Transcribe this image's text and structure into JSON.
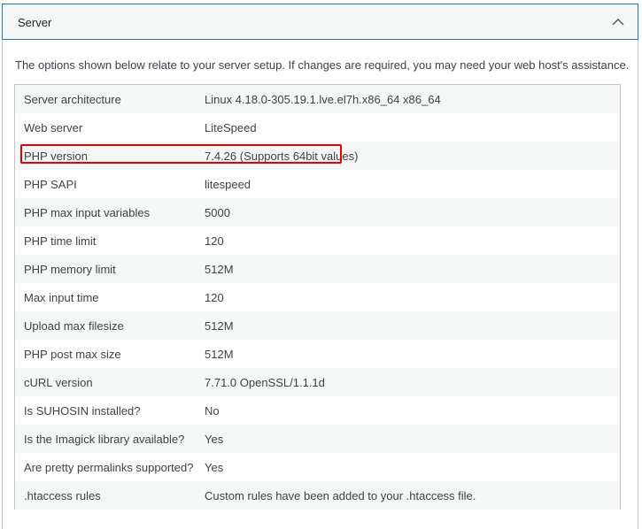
{
  "panel": {
    "title": "Server",
    "toggle_icon": "chevron-up-icon"
  },
  "intro": "The options shown below relate to your server setup. If changes are required, you may need your web host's assistance.",
  "rows": [
    {
      "label": "Server architecture",
      "value": "Linux 4.18.0-305.19.1.lve.el7h.x86_64 x86_64"
    },
    {
      "label": "Web server",
      "value": "LiteSpeed"
    },
    {
      "label": "PHP version",
      "value": "7.4.26 (Supports 64bit values)"
    },
    {
      "label": "PHP SAPI",
      "value": "litespeed"
    },
    {
      "label": "PHP max input variables",
      "value": "5000"
    },
    {
      "label": "PHP time limit",
      "value": "120"
    },
    {
      "label": "PHP memory limit",
      "value": "512M"
    },
    {
      "label": "Max input time",
      "value": "120"
    },
    {
      "label": "Upload max filesize",
      "value": "512M"
    },
    {
      "label": "PHP post max size",
      "value": "512M"
    },
    {
      "label": "cURL version",
      "value": "7.71.0 OpenSSL/1.1.1d"
    },
    {
      "label": "Is SUHOSIN installed?",
      "value": "No"
    },
    {
      "label": "Is the Imagick library available?",
      "value": "Yes"
    },
    {
      "label": "Are pretty permalinks supported?",
      "value": "Yes"
    },
    {
      "label": ".htaccess rules",
      "value": "Custom rules have been added to your .htaccess file."
    }
  ],
  "highlight_color": "#e60000",
  "accent_color": "#2271b1"
}
